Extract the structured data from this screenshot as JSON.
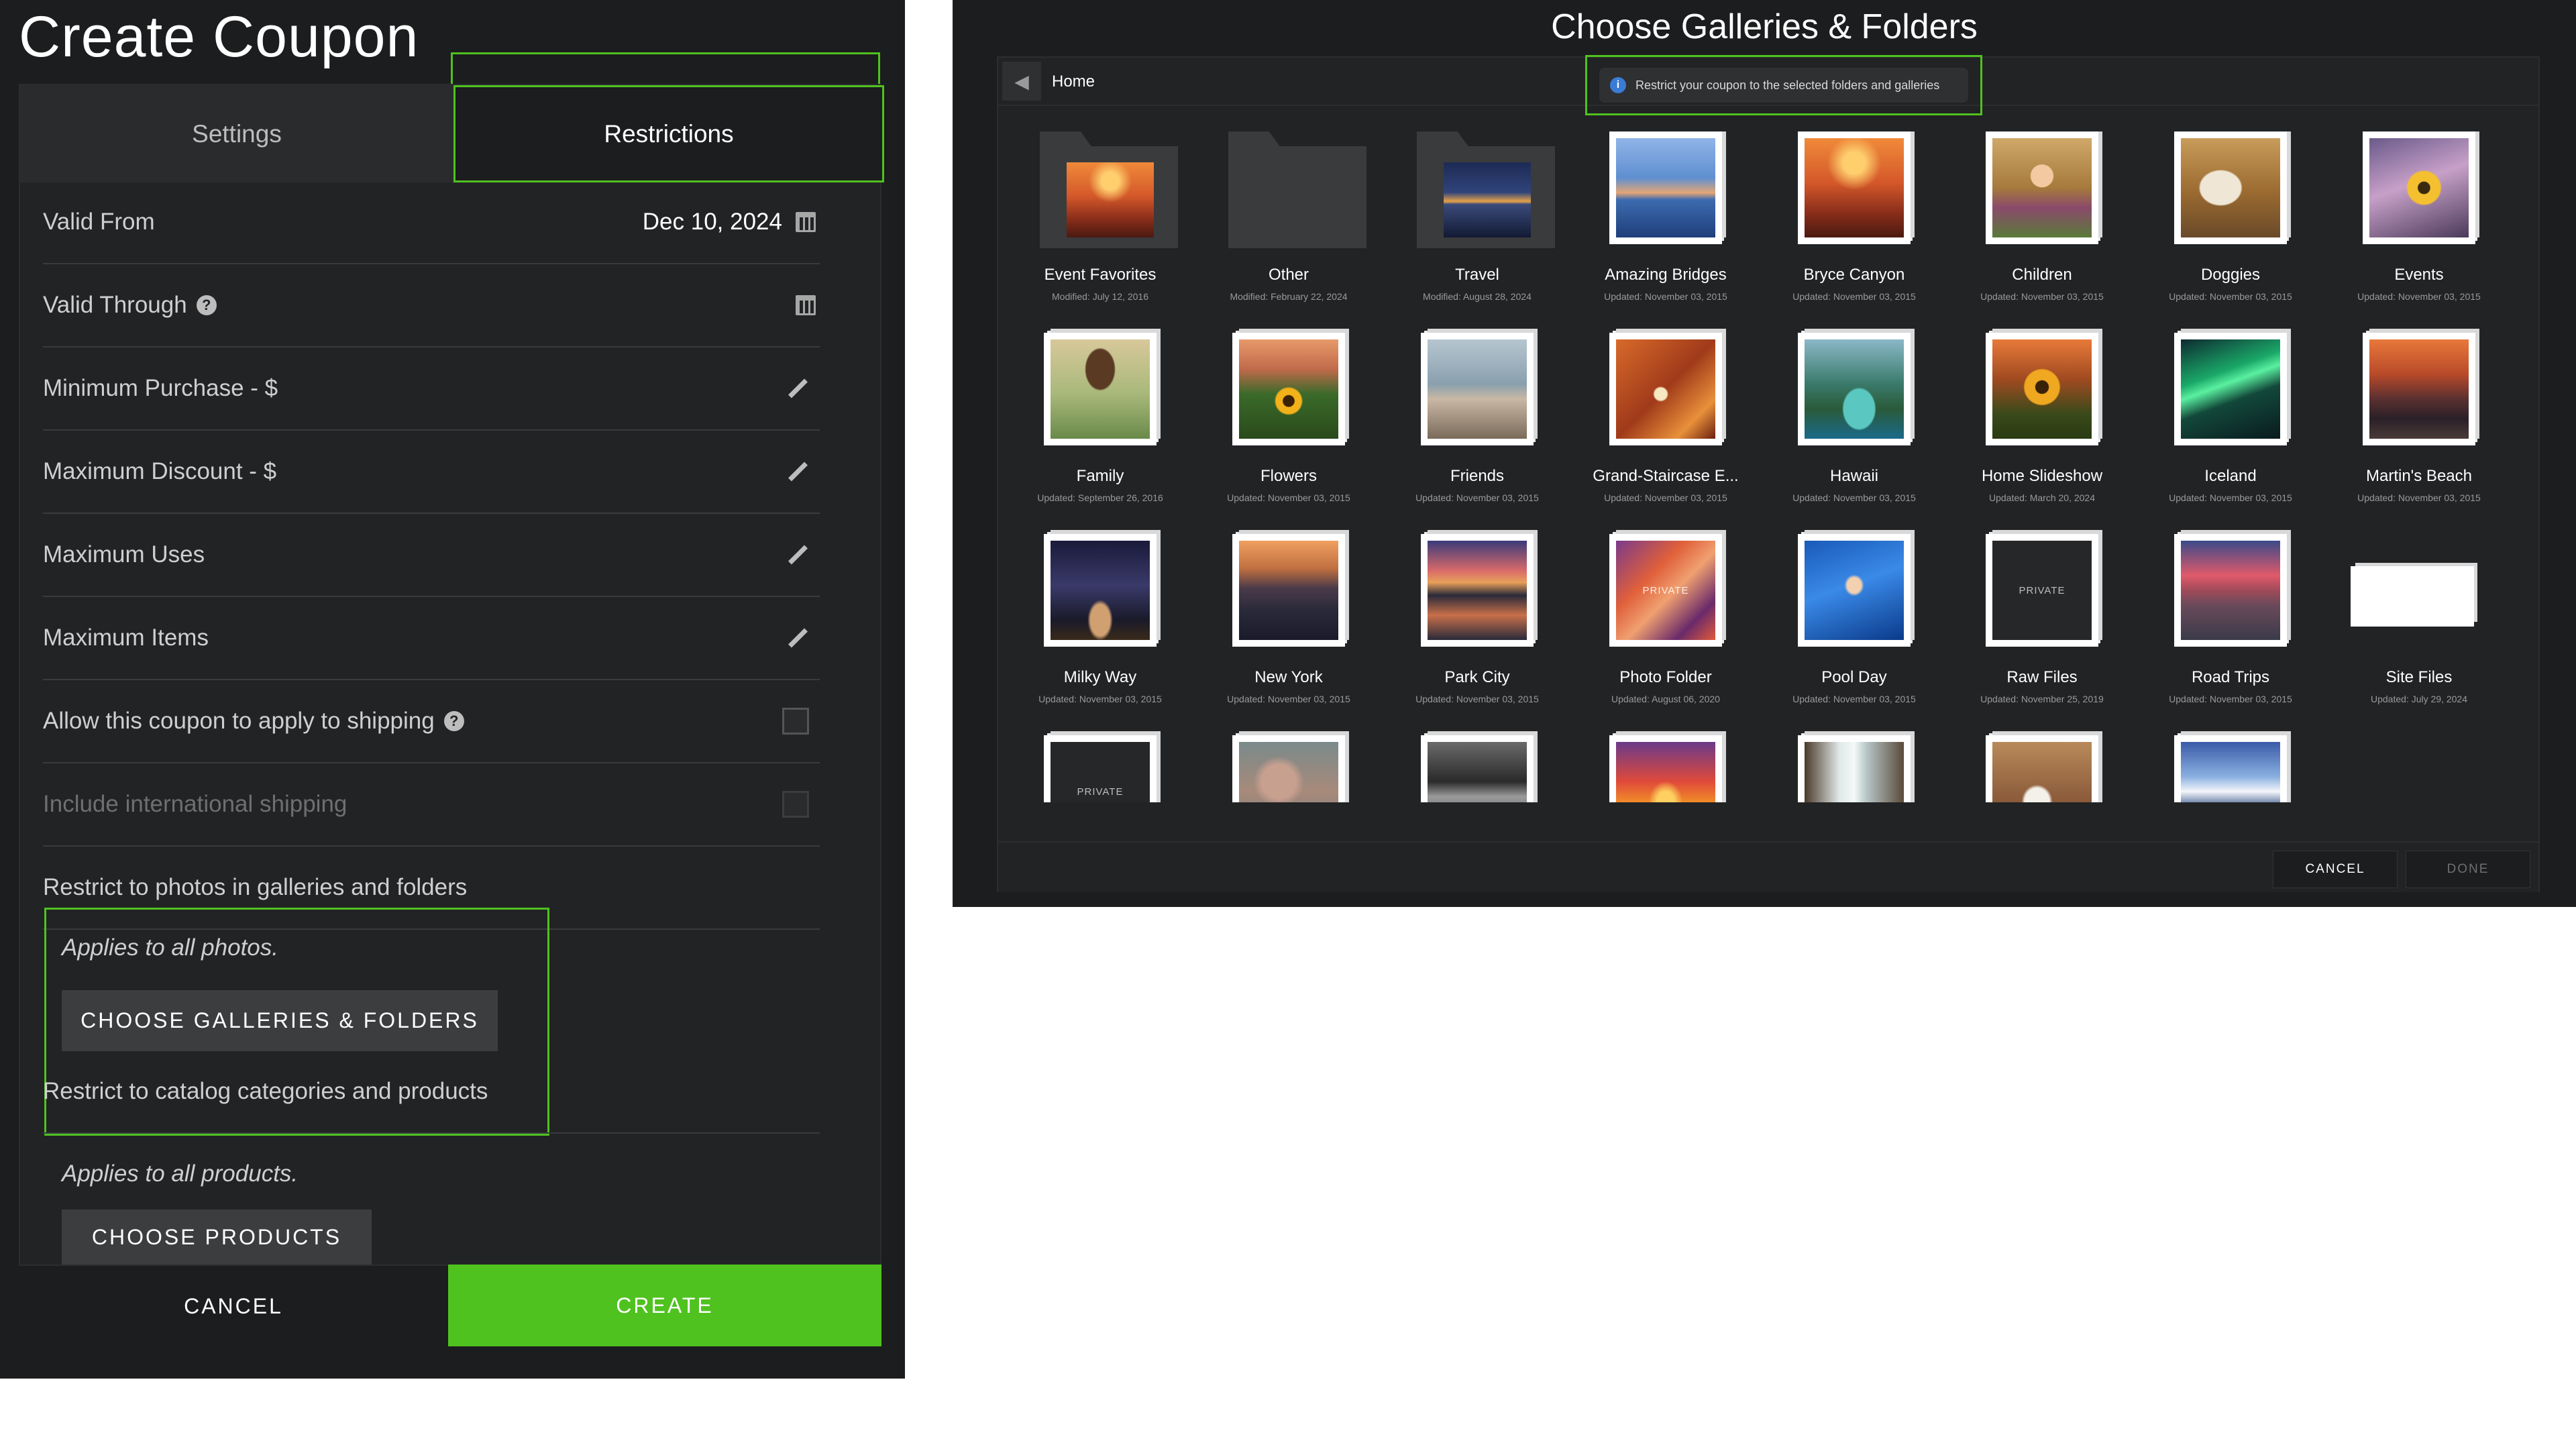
{
  "coupon": {
    "title": "Create Coupon",
    "tabs": {
      "settings": "Settings",
      "restrictions": "Restrictions"
    },
    "rows": {
      "valid_from_label": "Valid From",
      "valid_from_value": "Dec 10, 2024",
      "valid_through_label": "Valid Through",
      "min_purchase_label": "Minimum Purchase - $",
      "max_discount_label": "Maximum Discount - $",
      "max_uses_label": "Maximum Uses",
      "max_items_label": "Maximum Items",
      "shipping_label": "Allow this coupon to apply to shipping",
      "intl_shipping_label": "Include international shipping"
    },
    "galleries_section": {
      "label": "Restrict to photos in galleries and folders",
      "applies": "Applies to all photos.",
      "button": "CHOOSE GALLERIES & FOLDERS"
    },
    "products_section": {
      "label": "Restrict to catalog categories and products",
      "applies": "Applies to all products.",
      "button": "CHOOSE PRODUCTS"
    },
    "footer": {
      "cancel": "CANCEL",
      "create": "CREATE"
    },
    "accent": "#4fc21f"
  },
  "gallery": {
    "title": "Choose Galleries & Folders",
    "crumb": "Home",
    "info": "Restrict your coupon to the selected folders and galleries",
    "private_label": "PRIVATE",
    "footer": {
      "cancel": "CANCEL",
      "done": "DONE"
    },
    "items": [
      {
        "name": "Event Favorites",
        "meta": "Modified: July 12, 2016",
        "kind": "folder",
        "img": "canyon"
      },
      {
        "name": "Other",
        "meta": "Modified: February 22, 2024",
        "kind": "folder",
        "img": ""
      },
      {
        "name": "Travel",
        "meta": "Modified: August 28, 2024",
        "kind": "folder",
        "img": "bridge"
      },
      {
        "name": "Amazing Bridges",
        "meta": "Updated: November 03, 2015",
        "kind": "gallery",
        "img": "bay"
      },
      {
        "name": "Bryce Canyon",
        "meta": "Updated: November 03, 2015",
        "kind": "gallery",
        "img": "canyon"
      },
      {
        "name": "Children",
        "meta": "Updated: November 03, 2015",
        "kind": "gallery",
        "img": "child"
      },
      {
        "name": "Doggies",
        "meta": "Updated: November 03, 2015",
        "kind": "gallery",
        "img": "dog"
      },
      {
        "name": "Events",
        "meta": "Updated: November 03, 2015",
        "kind": "gallery",
        "img": "flower"
      },
      {
        "name": "Family",
        "meta": "Updated: September 26, 2016",
        "kind": "gallery",
        "img": "family"
      },
      {
        "name": "Flowers",
        "meta": "Updated: November 03, 2015",
        "kind": "gallery",
        "img": "sunflower"
      },
      {
        "name": "Friends",
        "meta": "Updated: November 03, 2015",
        "kind": "gallery",
        "img": "friends"
      },
      {
        "name": "Grand-Staircase E...",
        "meta": "Updated: November 03, 2015",
        "kind": "gallery",
        "img": "staircase"
      },
      {
        "name": "Hawaii",
        "meta": "Updated: November 03, 2015",
        "kind": "gallery",
        "img": "hawaii"
      },
      {
        "name": "Home Slideshow",
        "meta": "Updated: March 20, 2024",
        "kind": "gallery",
        "img": "sunflower2"
      },
      {
        "name": "Iceland",
        "meta": "Updated: November 03, 2015",
        "kind": "gallery",
        "img": "aurora"
      },
      {
        "name": "Martin's Beach",
        "meta": "Updated: November 03, 2015",
        "kind": "gallery",
        "img": "beach"
      },
      {
        "name": "Milky Way",
        "meta": "Updated: November 03, 2015",
        "kind": "gallery",
        "img": "milky"
      },
      {
        "name": "New York",
        "meta": "Updated: November 03, 2015",
        "kind": "gallery",
        "img": "city"
      },
      {
        "name": "Park City",
        "meta": "Updated: November 03, 2015",
        "kind": "gallery",
        "img": "lake"
      },
      {
        "name": "Photo Folder",
        "meta": "Updated: August 06, 2020",
        "kind": "gallery",
        "img": "antelope",
        "private": true
      },
      {
        "name": "Pool Day",
        "meta": "Updated: November 03, 2015",
        "kind": "gallery",
        "img": "pool"
      },
      {
        "name": "Raw Files",
        "meta": "Updated: November 25, 2019",
        "kind": "gallery",
        "img": "",
        "private": true
      },
      {
        "name": "Road Trips",
        "meta": "Updated: November 03, 2015",
        "kind": "gallery",
        "img": "road"
      },
      {
        "name": "Site Files",
        "meta": "Updated: July 29, 2024",
        "kind": "site",
        "img": ""
      },
      {
        "name": "",
        "meta": "",
        "kind": "gallery",
        "img": "",
        "private": true
      },
      {
        "name": "",
        "meta": "",
        "kind": "gallery",
        "img": "coral"
      },
      {
        "name": "",
        "meta": "",
        "kind": "gallery",
        "img": "bw"
      },
      {
        "name": "",
        "meta": "",
        "kind": "gallery",
        "img": "lava"
      },
      {
        "name": "",
        "meta": "",
        "kind": "gallery",
        "img": "waterfall"
      },
      {
        "name": "",
        "meta": "",
        "kind": "gallery",
        "img": "wedding"
      },
      {
        "name": "",
        "meta": "",
        "kind": "gallery",
        "img": "mountain"
      }
    ]
  }
}
